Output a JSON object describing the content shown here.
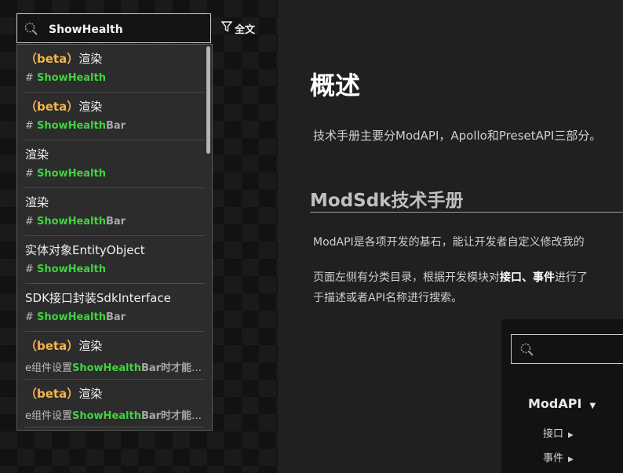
{
  "search": {
    "value": "ShowHealth",
    "placeholder": ""
  },
  "filter": {
    "label": "全文",
    "icon": "filter-icon"
  },
  "results": [
    {
      "beta": "（beta）",
      "title": "渲染",
      "prefix": "# ",
      "highlight": "ShowHealth",
      "tail": ""
    },
    {
      "beta": "（beta）",
      "title": "渲染",
      "prefix": "# ",
      "highlight": "ShowHealth",
      "tail": "Bar"
    },
    {
      "beta": "",
      "title": "渲染",
      "prefix": "# ",
      "highlight": "ShowHealth",
      "tail": ""
    },
    {
      "beta": "",
      "title": "渲染",
      "prefix": "# ",
      "highlight": "ShowHealth",
      "tail": "Bar"
    },
    {
      "beta": "",
      "title": "实体对象EntityObject",
      "prefix": "# ",
      "highlight": "ShowHealth",
      "tail": ""
    },
    {
      "beta": "",
      "title": "SDK接口封装SdkInterface",
      "prefix": "# ",
      "highlight": "ShowHealth",
      "tail": "Bar"
    },
    {
      "beta": "（beta）",
      "title": "渲染",
      "prefix": "e组件设置",
      "highlight": "ShowHealth",
      "tail": "Bar时才能显..."
    },
    {
      "beta": "（beta）",
      "title": "渲染",
      "prefix": "e组件设置",
      "highlight": "ShowHealth",
      "tail": "Bar时才能显..."
    }
  ],
  "main": {
    "title": "概述",
    "intro": "技术手册主要分ModAPI，Apollo和PresetAPI三部分。",
    "section_title": "ModSdk技术手册",
    "para1": "ModAPI是各项开发的基石，能让开发者自定义修改我的",
    "para2_a": "页面左侧有分类目录，根据开发模块对",
    "para2_b1": "接口",
    "para2_sep": "、",
    "para2_b2": "事件",
    "para2_c": "进行了",
    "para2_d": "于描述或者API名称进行搜索。"
  },
  "preview": {
    "nav_title": "ModAPI",
    "nav_items": [
      "接口",
      "事件"
    ]
  },
  "colors": {
    "highlight": "#3fd33f",
    "beta": "#f4b34a"
  }
}
